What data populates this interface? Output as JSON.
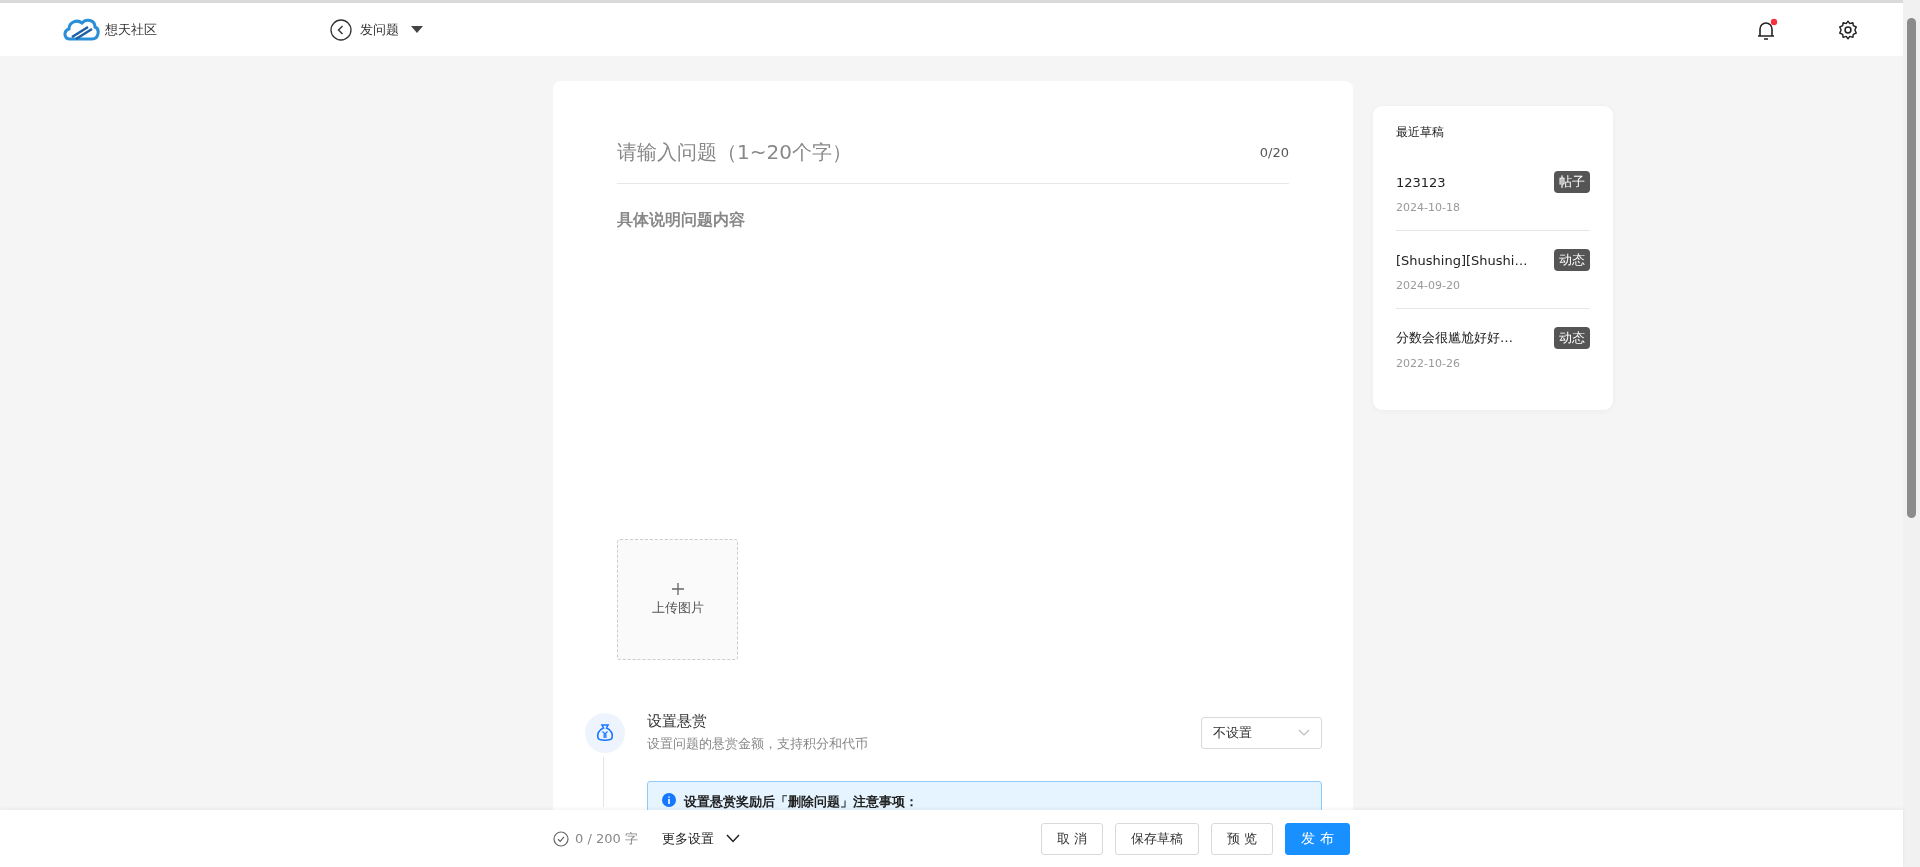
{
  "header": {
    "site_name": "想天社区",
    "page_title": "发问题",
    "notification_unread": true
  },
  "editor": {
    "title_placeholder": "请输入问题（1~20个字）",
    "title_counter": "0/20",
    "content_placeholder": "具体说明问题内容",
    "upload_label": "上传图片"
  },
  "reward": {
    "title": "设置悬赏",
    "description": "设置问题的悬赏金额，支持积分和代币",
    "select_value": "不设置",
    "notice": "设置悬赏奖励后「删除问题」注意事项："
  },
  "drafts": {
    "title": "最近草稿",
    "items": [
      {
        "title": "123123",
        "tag": "帖子",
        "date": "2024-10-18"
      },
      {
        "title": "[Shushing][Shushi…",
        "tag": "动态",
        "date": "2024-09-20"
      },
      {
        "title": "分数会很尴尬好好…",
        "tag": "动态",
        "date": "2022-10-26"
      }
    ]
  },
  "footer": {
    "word_count": "0 / 200 字",
    "more_settings": "更多设置",
    "buttons": [
      {
        "label": "取 消",
        "kind": "default"
      },
      {
        "label": "保存草稿",
        "kind": "default"
      },
      {
        "label": "预 览",
        "kind": "default"
      },
      {
        "label": "发 布",
        "kind": "primary"
      }
    ]
  }
}
